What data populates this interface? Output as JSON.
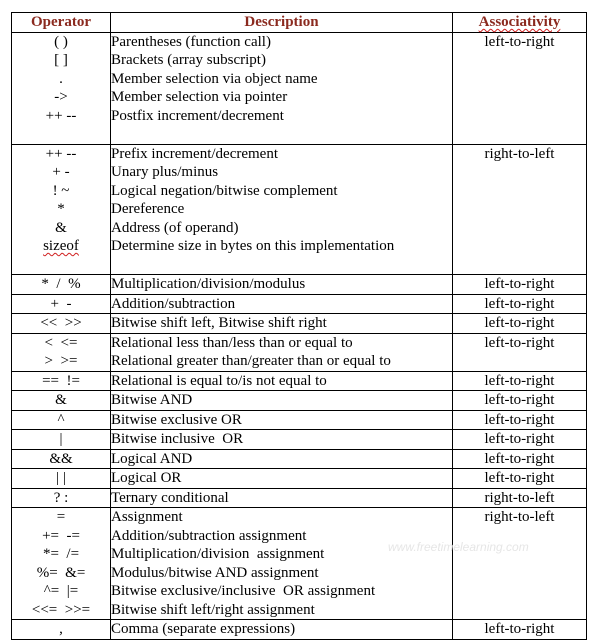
{
  "headers": {
    "operator": "Operator",
    "description": "Description",
    "associativity": "Associativity"
  },
  "header_color": "#8b2a1f",
  "groups": [
    {
      "operators": [
        "( )",
        "[ ]",
        ".",
        "->",
        "++ --"
      ],
      "descriptions": [
        "Parentheses (function call)",
        "Brackets (array subscript)",
        "Member selection via object name",
        "Member selection via pointer",
        "Postfix increment/decrement"
      ],
      "associativity": "left-to-right"
    },
    {
      "operators": [
        "++ --",
        "+ -",
        "! ~",
        "*",
        "&",
        "sizeof"
      ],
      "descriptions": [
        "Prefix increment/decrement",
        "Unary plus/minus",
        "Logical negation/bitwise complement",
        "Dereference",
        "Address (of operand)",
        "Determine size in bytes on this implementation"
      ],
      "associativity": "right-to-left"
    },
    {
      "operators": [
        "*  /  %"
      ],
      "descriptions": [
        "Multiplication/division/modulus"
      ],
      "associativity": "left-to-right"
    },
    {
      "operators": [
        "+  -"
      ],
      "descriptions": [
        "Addition/subtraction"
      ],
      "associativity": "left-to-right"
    },
    {
      "operators": [
        "<<  >>"
      ],
      "descriptions": [
        "Bitwise shift left, Bitwise shift right"
      ],
      "associativity": "left-to-right"
    },
    {
      "operators": [
        "<  <=",
        ">  >="
      ],
      "descriptions": [
        "Relational less than/less than or equal to",
        "Relational greater than/greater than or equal to"
      ],
      "associativity": "left-to-right"
    },
    {
      "operators": [
        "==  !="
      ],
      "descriptions": [
        "Relational is equal to/is not equal to"
      ],
      "associativity": "left-to-right"
    },
    {
      "operators": [
        "&"
      ],
      "descriptions": [
        "Bitwise AND"
      ],
      "associativity": "left-to-right"
    },
    {
      "operators": [
        "^"
      ],
      "descriptions": [
        "Bitwise exclusive OR"
      ],
      "associativity": "left-to-right"
    },
    {
      "operators": [
        "|"
      ],
      "descriptions": [
        "Bitwise inclusive  OR"
      ],
      "associativity": "left-to-right"
    },
    {
      "operators": [
        "&&"
      ],
      "descriptions": [
        "Logical AND"
      ],
      "associativity": "left-to-right"
    },
    {
      "operators": [
        "| |"
      ],
      "descriptions": [
        "Logical OR"
      ],
      "associativity": "left-to-right"
    },
    {
      "operators": [
        "? :"
      ],
      "descriptions": [
        "Ternary conditional"
      ],
      "associativity": "right-to-left"
    },
    {
      "operators": [
        "=",
        "+=  -=",
        "*=  /=",
        "%=  &=",
        "^=  |=",
        "<<=  >>="
      ],
      "descriptions": [
        "Assignment",
        "Addition/subtraction assignment",
        "Multiplication/division  assignment",
        "Modulus/bitwise AND assignment",
        "Bitwise exclusive/inclusive  OR assignment",
        "Bitwise shift left/right assignment"
      ],
      "associativity": "right-to-left"
    },
    {
      "operators": [
        ","
      ],
      "descriptions": [
        "Comma (separate expressions)"
      ],
      "associativity": "left-to-right"
    }
  ],
  "watermark": "www.freetimelearning.com"
}
